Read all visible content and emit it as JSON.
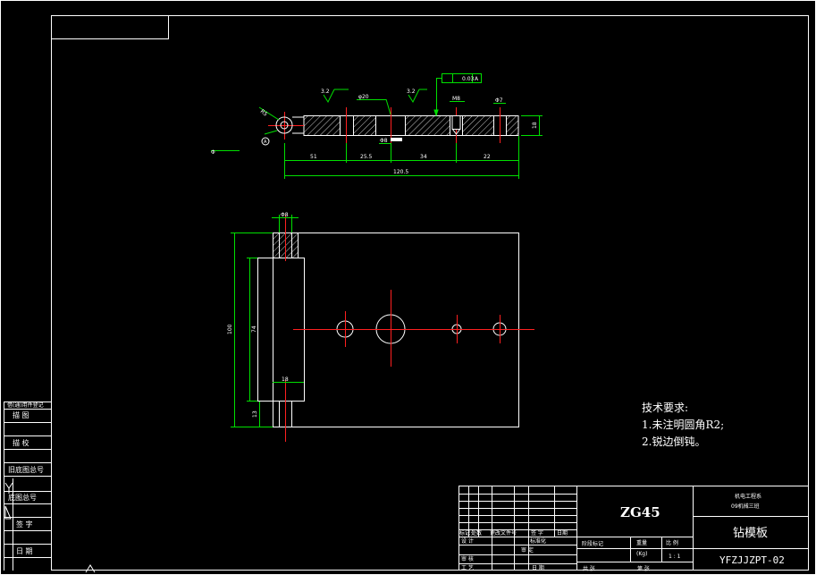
{
  "drawing": {
    "material": "ZG45",
    "part_name": "钻模板",
    "drawing_number": "YFZJJZPT-02",
    "school_line1": "机电工程系",
    "school_line2": "09机械三班",
    "scale_label": "比 例",
    "scale_value": "1 : 1",
    "weight_label": "重量",
    "weight_unit": "(Kg)",
    "stage_label": "阶段标记",
    "sheet_total": "共    张",
    "sheet_no": "第    张"
  },
  "tech_requirements": {
    "title": "技术要求:",
    "items": [
      "1.未注明圆角R2;",
      "2.锐边倒钝。"
    ]
  },
  "titleblock": {
    "revision_row": [
      "标记",
      "处数",
      "更改文件号",
      "签 字",
      "日期"
    ],
    "design": "设 计",
    "standardize": "标准化",
    "check": "审 核",
    "process": "工 艺",
    "approve": "审 定",
    "date": "日 期",
    "standardize2": "标准化"
  },
  "sidebar": {
    "labels": [
      "借(通)用件登记",
      "描 图",
      "描 校",
      "旧底图总号",
      "底图总号",
      "签 字",
      "日 期"
    ]
  },
  "dimensions": {
    "top": {
      "d51": "51",
      "d25_5": "25.5",
      "d34": "34",
      "d22": "22",
      "d120_5": "120.5",
      "thickness": "18",
      "tolerance": "0.03",
      "datum": "A",
      "r5": "R5",
      "phi": "Φ",
      "m8": "M8",
      "phi7": "Φ7",
      "phi20": "φ20",
      "phi8": "Φ8",
      "rough1": "3.2",
      "rough2": "3.2"
    },
    "front": {
      "d100": "100",
      "d74": "74",
      "d13": "13",
      "d18": "18",
      "d8": "Φ8"
    }
  }
}
